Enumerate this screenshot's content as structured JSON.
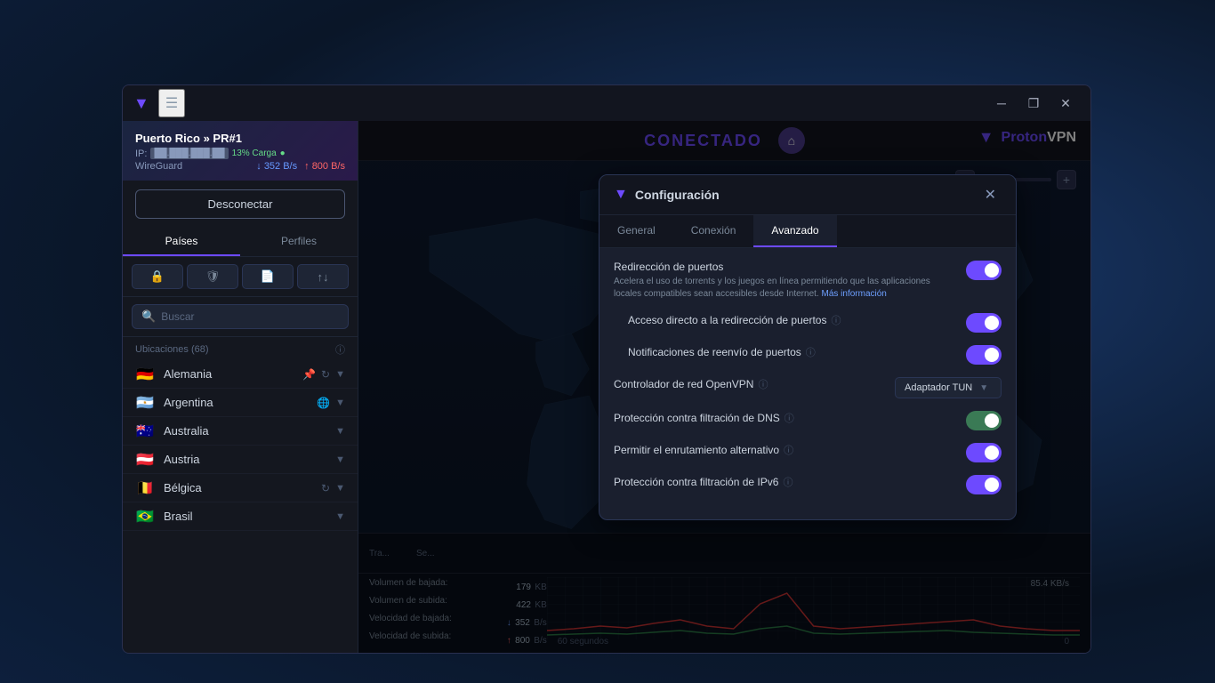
{
  "app": {
    "title": "ProtonVPN",
    "logo_text": "ProtonVPN",
    "logo_accent": "Proton"
  },
  "titlebar": {
    "minimize_label": "─",
    "maximize_label": "❐",
    "close_label": "✕"
  },
  "connection": {
    "location": "Puerto Rico » PR#1",
    "ip_label": "IP:",
    "ip_masked": "██.███.███.██",
    "load_label": "13% Carga",
    "protocol": "WireGuard",
    "speed_down": "352 B/s",
    "speed_up": "800 B/s",
    "speed_down_arrow": "↓",
    "speed_up_arrow": "↑"
  },
  "buttons": {
    "disconnect": "Desconectar",
    "countries_tab": "Países",
    "profiles_tab": "Perfiles"
  },
  "filters": {
    "lock_icon": "🔒",
    "shield_icon": "🛡",
    "router_icon": "📄",
    "signal_icon": "↑"
  },
  "search": {
    "placeholder": "Buscar"
  },
  "locations": {
    "label": "Ubicaciones (68)",
    "countries": [
      {
        "flag": "🇩🇪",
        "name": "Alemania",
        "has_pin": true,
        "has_refresh": true
      },
      {
        "flag": "🇦🇷",
        "name": "Argentina",
        "has_globe": true
      },
      {
        "flag": "🇦🇺",
        "name": "Australia"
      },
      {
        "flag": "🇦🇹",
        "name": "Austria"
      },
      {
        "flag": "🇧🇪",
        "name": "Bélgica",
        "has_refresh": true
      },
      {
        "flag": "🇧🇷",
        "name": "Brasil"
      }
    ]
  },
  "map": {
    "status": "CONECTADO",
    "markers_count": 8
  },
  "stats": {
    "transfer_label": "Tra...",
    "upload_label": "Se...",
    "down_label": "Volumen de bajada:",
    "down_value": "179",
    "down_unit": "KB",
    "up_label": "Volumen de subida:",
    "up_value": "422",
    "up_unit": "KB",
    "speed_down_label": "Velocidad de bajada:",
    "speed_down_value": "352",
    "speed_down_unit": "B/s",
    "speed_up_label": "Velocidad de subida:",
    "speed_up_value": "800",
    "speed_up_unit": "B/s",
    "time_label": "60 segundos",
    "max_label": "85.4 KB/s",
    "zero_label": "0"
  },
  "modal": {
    "title": "Configuración",
    "close_label": "✕",
    "tabs": [
      {
        "id": "general",
        "label": "General"
      },
      {
        "id": "conexion",
        "label": "Conexión"
      },
      {
        "id": "avanzado",
        "label": "Avanzado"
      }
    ],
    "active_tab": "avanzado",
    "settings": {
      "port_forwarding": {
        "label": "Redirección de puertos",
        "enabled": true,
        "desc": "Acelera el uso de torrents y los juegos en línea permitiendo que las aplicaciones locales compatibles sean accesibles desde Internet.",
        "link_text": "Más información"
      },
      "direct_access": {
        "label": "Acceso directo a la redirección de puertos",
        "enabled": true
      },
      "port_notifications": {
        "label": "Notificaciones de reenvío de puertos",
        "enabled": true
      },
      "openvpn_controller": {
        "label": "Controlador de red OpenVPN",
        "value": "Adaptador TUN"
      },
      "dns_leak": {
        "label": "Protección contra filtración de DNS",
        "enabled": false
      },
      "alt_routing": {
        "label": "Permitir el enrutamiento alternativo",
        "enabled": true
      },
      "ipv6_leak": {
        "label": "Protección contra filtración de IPv6",
        "enabled": true
      }
    }
  }
}
